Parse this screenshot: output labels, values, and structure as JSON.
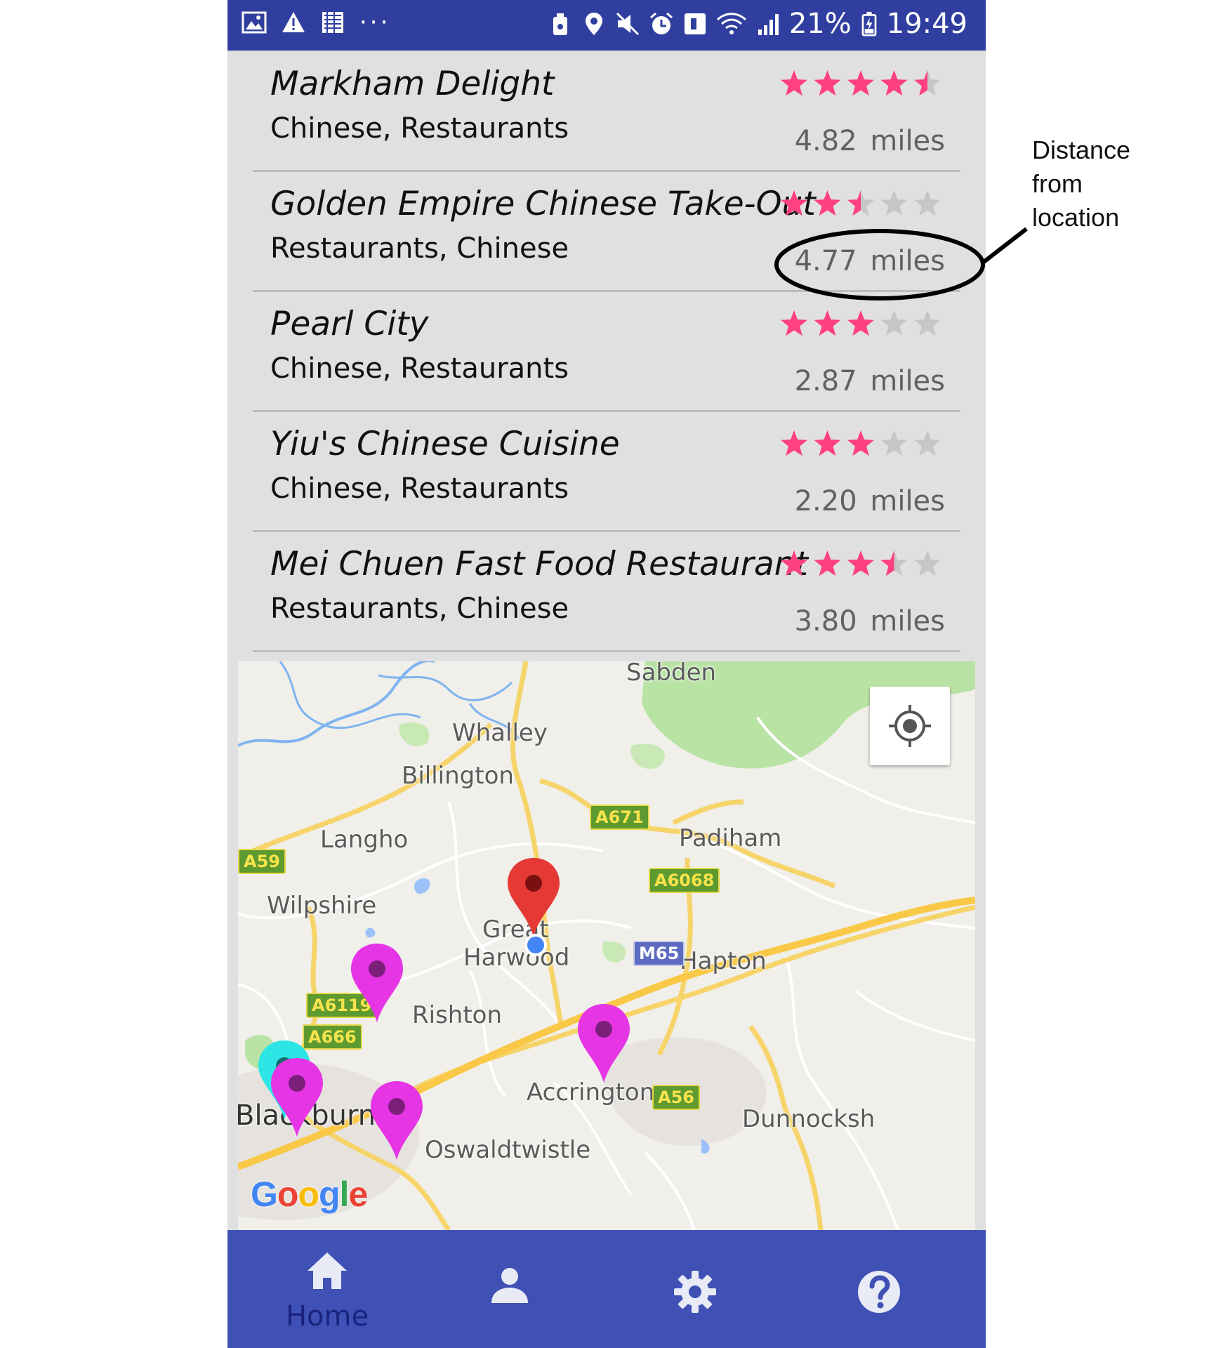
{
  "status_bar": {
    "battery_percent": "21%",
    "time": "19:49",
    "left_icons": [
      "image-icon",
      "warning-icon",
      "news-icon",
      "more-dots-icon"
    ],
    "right_icons": [
      "cleaner-icon",
      "location-icon",
      "mute-icon",
      "alarm-icon",
      "nfc-icon",
      "wifi-icon",
      "signal-icon",
      "battery-icon"
    ]
  },
  "restaurants": [
    {
      "name": "Markham Delight",
      "categories": "Chinese, Restaurants",
      "rating": 4.5,
      "distance_value": "4.82",
      "distance_unit": "miles"
    },
    {
      "name": "Golden Empire Chinese Take-Out",
      "categories": "Restaurants, Chinese",
      "rating": 2.5,
      "distance_value": "4.77",
      "distance_unit": "miles"
    },
    {
      "name": "Pearl City",
      "categories": "Chinese, Restaurants",
      "rating": 3,
      "distance_value": "2.87",
      "distance_unit": "miles"
    },
    {
      "name": "Yiu's Chinese Cuisine",
      "categories": "Chinese, Restaurants",
      "rating": 3,
      "distance_value": "2.20",
      "distance_unit": "miles"
    },
    {
      "name": "Mei Chuen Fast Food Restaurant",
      "categories": "Restaurants, Chinese",
      "rating": 3.5,
      "distance_value": "3.80",
      "distance_unit": "miles"
    }
  ],
  "colors": {
    "status_bar": "#303f9f",
    "nav_bar": "#3f51b5",
    "star_filled": "#ff4081",
    "star_empty": "#c6c6c6",
    "pin_current": "#e53935",
    "pin_restaurant": "#e535e5",
    "pin_highlight": "#2ee5e5"
  },
  "map": {
    "places": {
      "sabden": "Sabden",
      "whalley": "Whalley",
      "billington": "Billington",
      "langho": "Langho",
      "padiham": "Padiham",
      "wilpshire": "Wilpshire",
      "great": "Great",
      "harwood": "Harwood",
      "hapton": "Hapton",
      "rishton": "Rishton",
      "accrington": "Accrington",
      "blackburn": "Blackburn",
      "oswaldtwistle": "Oswaldtwistle",
      "dunnockshaw": "Dunnocksh"
    },
    "roads": {
      "a671": "A671",
      "a59": "A59",
      "a6068": "A6068",
      "m65": "M65",
      "a6119": "A6119",
      "a666": "A666",
      "a56": "A56"
    },
    "logo": "Google",
    "locate_icon": "my-location-icon"
  },
  "nav": {
    "items": [
      {
        "icon": "home-icon",
        "label": "Home"
      },
      {
        "icon": "person-icon",
        "label": ""
      },
      {
        "icon": "gear-icon",
        "label": ""
      },
      {
        "icon": "help-icon",
        "label": ""
      }
    ]
  },
  "annotation": {
    "line1": "Distance",
    "line2": "from",
    "line3": "location"
  }
}
